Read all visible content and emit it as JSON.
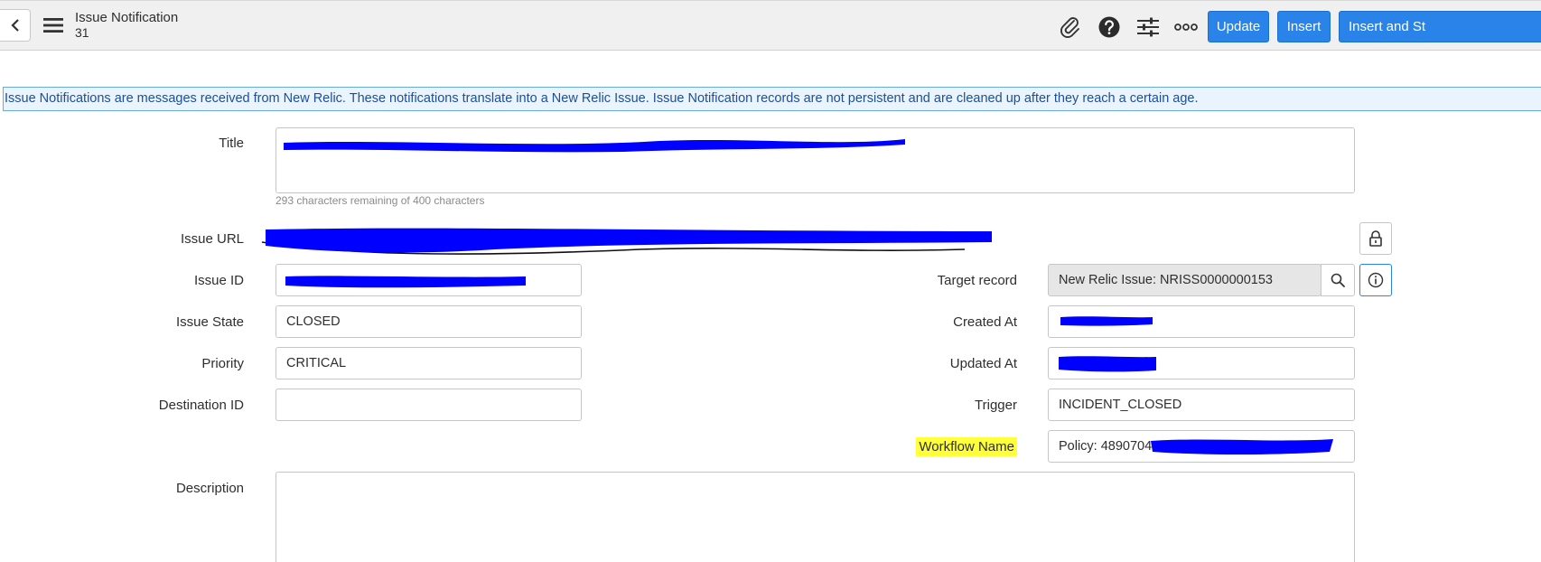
{
  "header": {
    "title": "Issue Notification",
    "subtitle": "31",
    "icons": [
      "chevron-left-icon",
      "hamburger-menu-icon",
      "paperclip-icon",
      "help-icon",
      "sliders-icon",
      "more-icon"
    ],
    "buttons": {
      "update": "Update",
      "insert": "Insert",
      "insert_and_stay": "Insert and St"
    }
  },
  "banner": {
    "text": "Issue Notifications are messages received from New Relic. These notifications translate into a New Relic Issue. Issue Notification records are not persistent and are cleaned up after they reach a certain age."
  },
  "form": {
    "title": {
      "label": "Title",
      "value": "",
      "hint": "293 characters remaining of 400 characters"
    },
    "issue_url": {
      "label": "Issue URL",
      "value": ""
    },
    "issue_id": {
      "label": "Issue ID",
      "value": ""
    },
    "issue_state": {
      "label": "Issue State",
      "value": "CLOSED"
    },
    "priority": {
      "label": "Priority",
      "value": "CRITICAL"
    },
    "destination_id": {
      "label": "Destination ID",
      "value": ""
    },
    "description": {
      "label": "Description",
      "value": ""
    },
    "target_record": {
      "label": "Target record",
      "value": "New Relic Issue: NRISS0000000153"
    },
    "created_at": {
      "label": "Created At",
      "value": ""
    },
    "updated_at": {
      "label": "Updated At",
      "value": ""
    },
    "trigger": {
      "label": "Trigger",
      "value": "INCIDENT_CLOSED"
    },
    "workflow_name": {
      "label": "Workflow Name",
      "value": "Policy: 4890704 -"
    }
  },
  "colors": {
    "primary_button": "#2a83e8",
    "banner_bg": "#eaf4fd",
    "banner_text": "#1f4e96",
    "redaction": "#0000ff",
    "highlight": "#ffff3a"
  }
}
